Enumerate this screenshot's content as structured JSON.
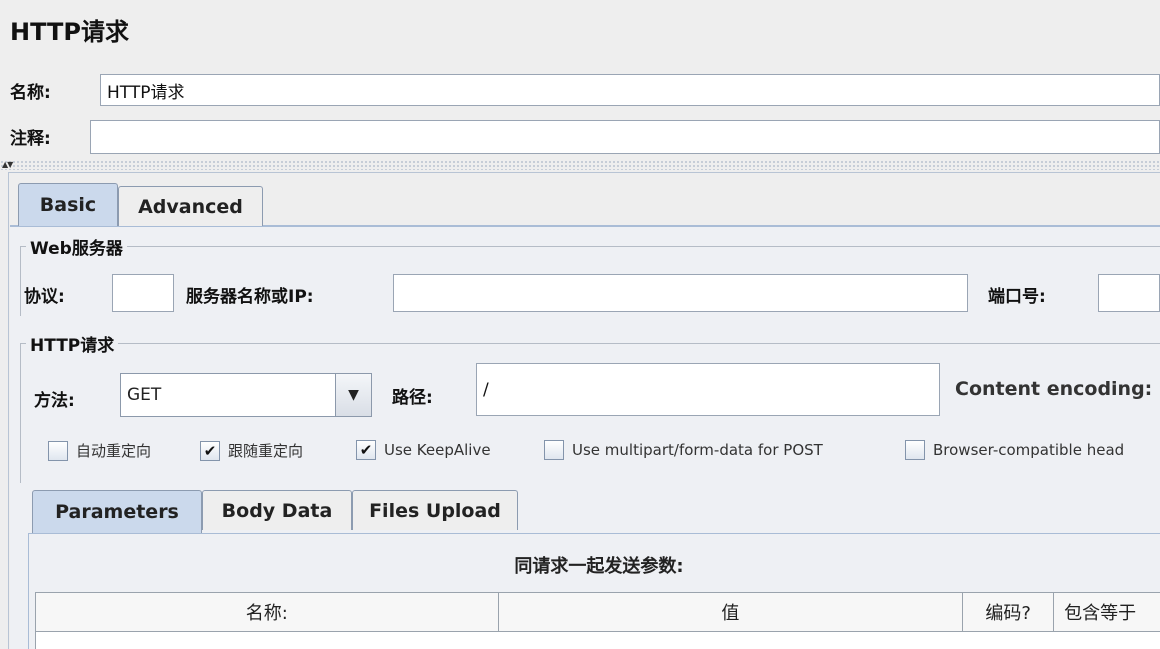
{
  "header": {
    "title": "HTTP请求"
  },
  "name_field": {
    "label": "名称:",
    "value": "HTTP请求"
  },
  "comment_field": {
    "label": "注释:",
    "value": ""
  },
  "main_tabs": [
    {
      "label": "Basic",
      "active": true
    },
    {
      "label": "Advanced",
      "active": false
    }
  ],
  "web_server": {
    "group_title": "Web服务器",
    "protocol_label": "协议:",
    "protocol_value": "",
    "server_label": "服务器名称或IP:",
    "server_value": "",
    "port_label": "端口号:",
    "port_value": ""
  },
  "http_request": {
    "group_title": "HTTP请求",
    "method_label": "方法:",
    "method_value": "GET",
    "path_label": "路径:",
    "path_value": "/",
    "encoding_label": "Content encoding:"
  },
  "options": [
    {
      "label": "自动重定向",
      "checked": false
    },
    {
      "label": "跟随重定向",
      "checked": true
    },
    {
      "label": "Use KeepAlive",
      "checked": true
    },
    {
      "label": "Use multipart/form-data for POST",
      "checked": false
    },
    {
      "label": "Browser-compatible head",
      "checked": false
    }
  ],
  "check_mark": "✔",
  "sub_tabs": [
    {
      "label": "Parameters",
      "active": true
    },
    {
      "label": "Body Data",
      "active": false
    },
    {
      "label": "Files Upload",
      "active": false
    }
  ],
  "params": {
    "caption": "同请求一起发送参数:",
    "columns": [
      "名称:",
      "值",
      "编码?",
      "包含等于"
    ]
  },
  "icons": {
    "combo": "chevron-down-icon",
    "splitter": "split-arrows-icon"
  },
  "colors": {
    "active_tab": "#cbd9ec",
    "panel_border": "#a9bcd6"
  }
}
